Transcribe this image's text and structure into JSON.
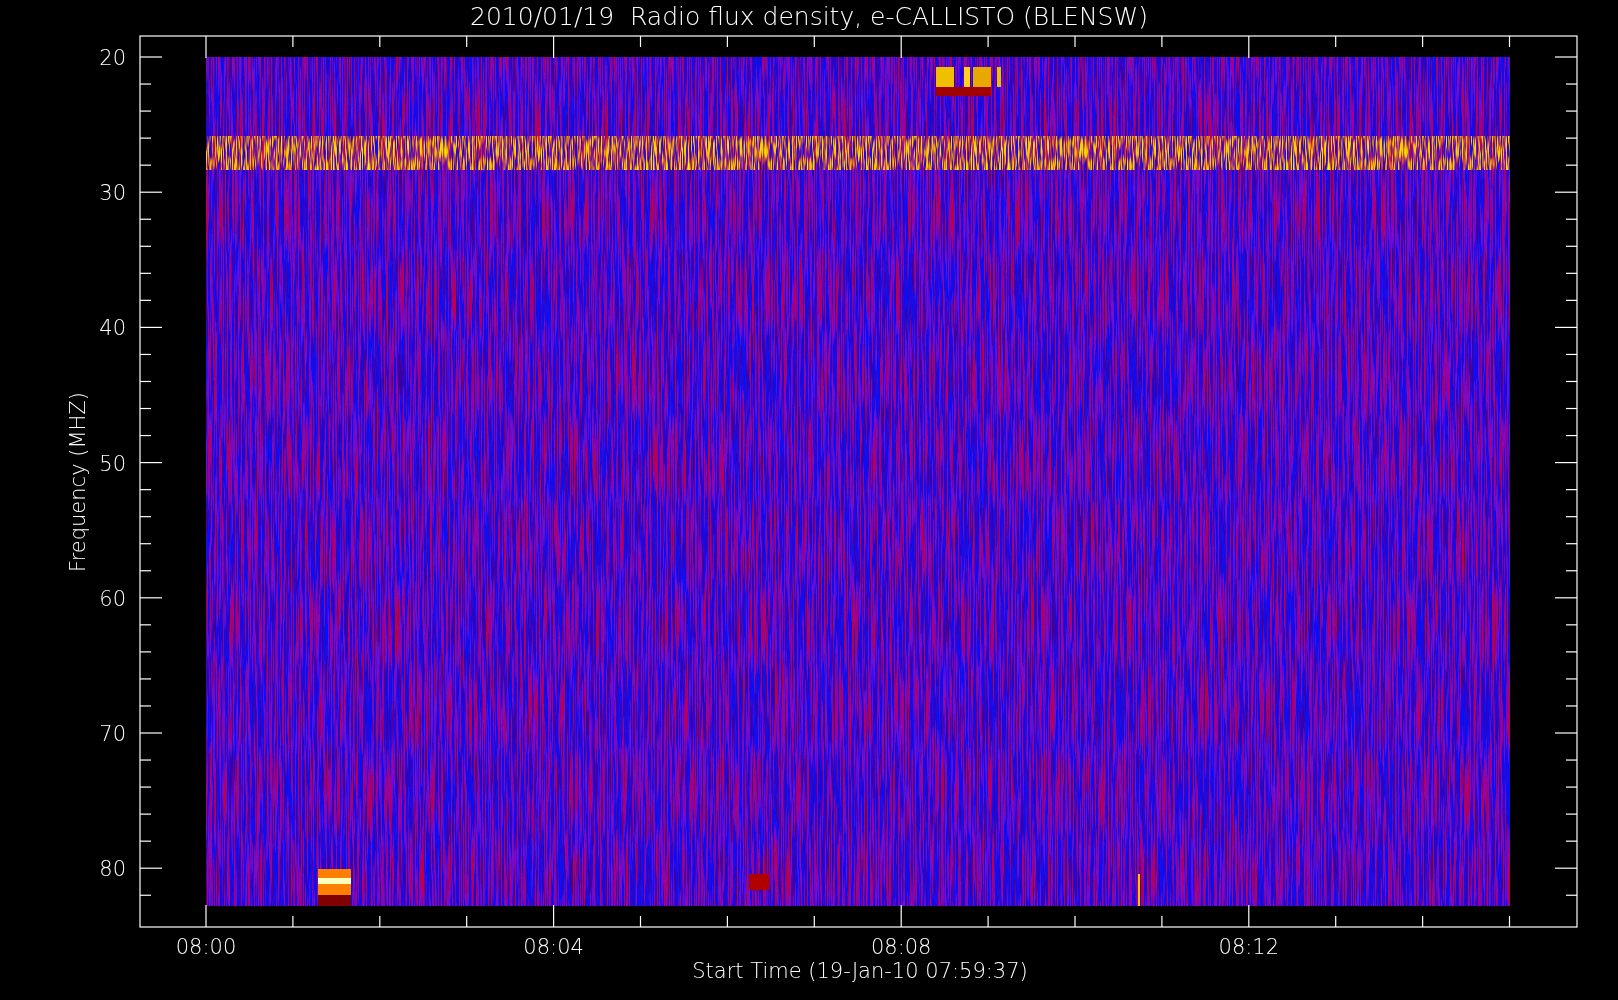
{
  "title": "2010/01/19  Radio flux density, e-CALLISTO (BLENSW)",
  "y_axis": {
    "label": "Frequency (MHZ)",
    "ticks": [
      "20",
      "30",
      "40",
      "50",
      "60",
      "70",
      "80"
    ]
  },
  "x_axis": {
    "label": "Start Time (19-Jan-10 07:59:37)",
    "ticks": [
      "08:00",
      "08:04",
      "08:08",
      "08:12"
    ]
  }
}
